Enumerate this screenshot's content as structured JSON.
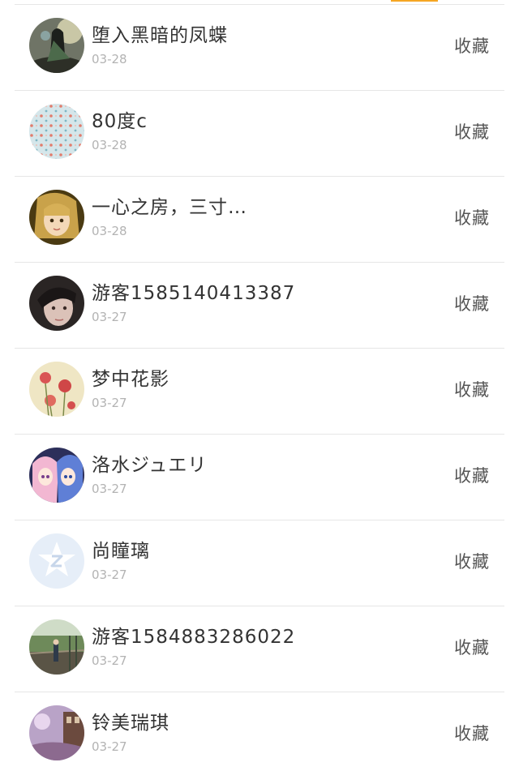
{
  "list": {
    "items": [
      {
        "name": "堕入黑暗的凤蝶",
        "date": "03-28",
        "action": "收藏",
        "avatar_icon": "avatar-dark-figure-icon"
      },
      {
        "name": "80度c",
        "date": "03-28",
        "action": "收藏",
        "avatar_icon": "avatar-pattern-icon"
      },
      {
        "name": "一心之房，三寸…",
        "date": "03-28",
        "action": "收藏",
        "avatar_icon": "avatar-doll-icon"
      },
      {
        "name": "游客1585140413387",
        "date": "03-27",
        "action": "收藏",
        "avatar_icon": "avatar-portrait-icon"
      },
      {
        "name": "梦中花影",
        "date": "03-27",
        "action": "收藏",
        "avatar_icon": "avatar-flower-icon"
      },
      {
        "name": "洛水ジュエリ",
        "date": "03-27",
        "action": "收藏",
        "avatar_icon": "avatar-anime-icon"
      },
      {
        "name": "尚瞳璃",
        "date": "03-27",
        "action": "收藏",
        "avatar_icon": "avatar-qq-default-icon"
      },
      {
        "name": "游客1584883286022",
        "date": "03-27",
        "action": "收藏",
        "avatar_icon": "avatar-landscape-icon"
      },
      {
        "name": "铃美瑞琪",
        "date": "03-27",
        "action": "收藏",
        "avatar_icon": "avatar-scenery-icon"
      }
    ]
  },
  "colors": {
    "accent": "#f5a623",
    "divider": "#e6e6e6",
    "name_text": "#333333",
    "date_text": "#b3b3b3",
    "action_text": "#555555"
  }
}
